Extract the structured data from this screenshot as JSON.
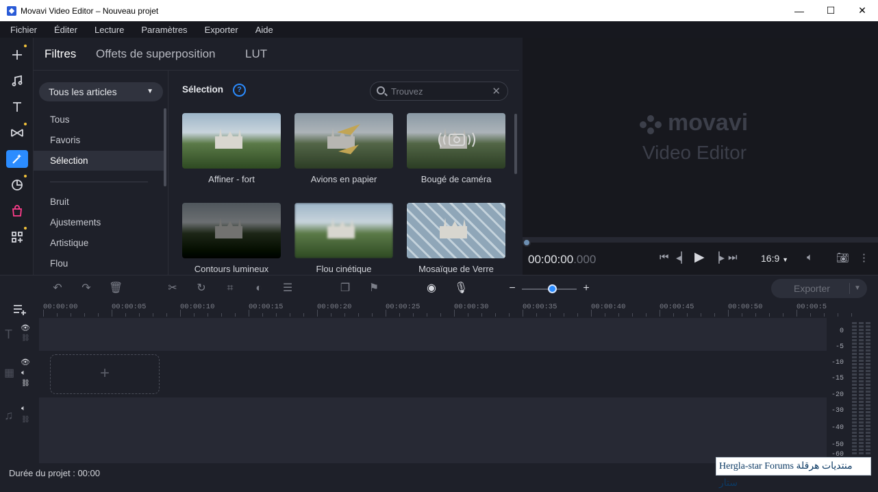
{
  "window": {
    "title": "Movavi Video Editor – Nouveau projet",
    "minimize": "—",
    "maximize": "☐",
    "close": "✕"
  },
  "menu": [
    "Fichier",
    "Éditer",
    "Lecture",
    "Paramètres",
    "Exporter",
    "Aide"
  ],
  "tabs": [
    "Filtres",
    "Offets de superposition",
    "LUT"
  ],
  "sidebar": {
    "dropdown": "Tous les articles",
    "items": [
      "Tous",
      "Favoris",
      "Sélection",
      "Bruit",
      "Ajustements",
      "Artistique",
      "Flou"
    ]
  },
  "grid": {
    "title": "Sélection",
    "help": "?",
    "search_placeholder": "Trouvez",
    "search_clear": "✕",
    "items": [
      "Affiner - fort",
      "Avions en papier",
      "Bougé de caméra",
      "Contours lumineux",
      "Flou cinétique",
      "Mosaïque de Verre"
    ]
  },
  "player": {
    "logo": "movavi",
    "logo_sub": "Video Editor",
    "time_main": "00:00:00",
    "time_ms": ".000",
    "ratio": "16:9"
  },
  "toolbar": {
    "export_label": "Exporter",
    "zoom_level": 0.55
  },
  "ruler": [
    "00:00:00",
    "00:00:05",
    "00:00:10",
    "00:00:15",
    "00:00:20",
    "00:00:25",
    "00:00:30",
    "00:00:35",
    "00:00:40",
    "00:00:45",
    "00:00:50",
    "00:00:5"
  ],
  "meter_labels": [
    "0",
    "-5",
    "-10",
    "-15",
    "-20",
    "-30",
    "-40",
    "-50",
    "-60"
  ],
  "status": {
    "duration": "Durée du projet : 00:00"
  },
  "watermark": "Hergla-star Forums منتديات هرقلة ستار"
}
